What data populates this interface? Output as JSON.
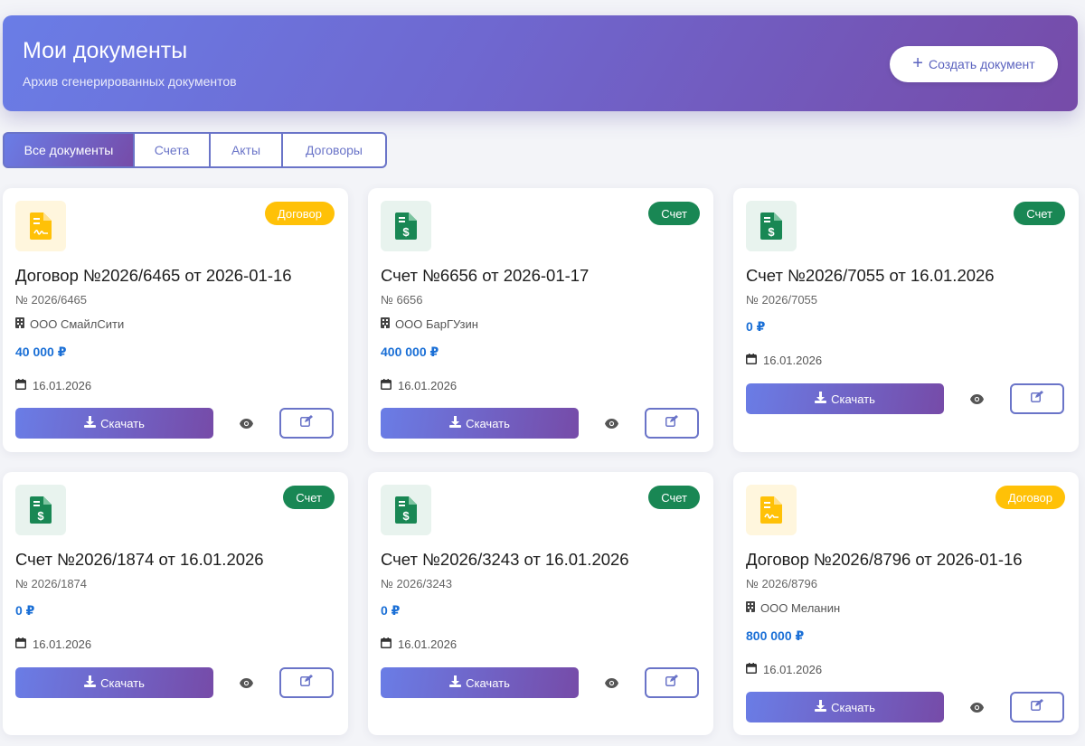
{
  "header": {
    "title": "Мои документы",
    "subtitle": "Архив сгенерированных документов",
    "create_button": "Создать документ"
  },
  "tabs": [
    {
      "label": "Все документы",
      "active": true
    },
    {
      "label": "Счета",
      "active": false
    },
    {
      "label": "Акты",
      "active": false
    },
    {
      "label": "Договоры",
      "active": false
    }
  ],
  "colors": {
    "accent_start": "#6a7de6",
    "accent_end": "#764ba8",
    "amount": "#1a6fd6",
    "badge_contract": "#ffc107",
    "badge_invoice": "#198754"
  },
  "cards": [
    {
      "icon": "file-contract-icon",
      "badge": "Договор",
      "title": "Договор №2026/6465 от 2026-01-16",
      "number": "№ 2026/6465",
      "org": "ООО СмайлСити",
      "amount": "40 000 ₽",
      "date": "16.01.2026",
      "download": "Скачать"
    },
    {
      "icon": "file-invoice-dollar-icon",
      "badge": "Счет",
      "title": "Счет №6656 от 2026-01-17",
      "number": "№ 6656",
      "org": "ООО БарГУзин",
      "amount": "400 000 ₽",
      "date": "16.01.2026",
      "download": "Скачать"
    },
    {
      "icon": "file-invoice-dollar-icon",
      "badge": "Счет",
      "title": "Счет №2026/7055 от 16.01.2026",
      "number": "№ 2026/7055",
      "org": null,
      "amount": "0 ₽",
      "date": "16.01.2026",
      "download": "Скачать"
    },
    {
      "icon": "file-invoice-dollar-icon",
      "badge": "Счет",
      "title": "Счет №2026/1874 от 16.01.2026",
      "number": "№ 2026/1874",
      "org": null,
      "amount": "0 ₽",
      "date": "16.01.2026",
      "download": "Скачать"
    },
    {
      "icon": "file-invoice-dollar-icon",
      "badge": "Счет",
      "title": "Счет №2026/3243 от 16.01.2026",
      "number": "№ 2026/3243",
      "org": null,
      "amount": "0 ₽",
      "date": "16.01.2026",
      "download": "Скачать"
    },
    {
      "icon": "file-contract-icon",
      "badge": "Договор",
      "title": "Договор №2026/8796 от 2026-01-16",
      "number": "№ 2026/8796",
      "org": "ООО Меланин",
      "amount": "800 000 ₽",
      "date": "16.01.2026",
      "download": "Скачать"
    }
  ]
}
